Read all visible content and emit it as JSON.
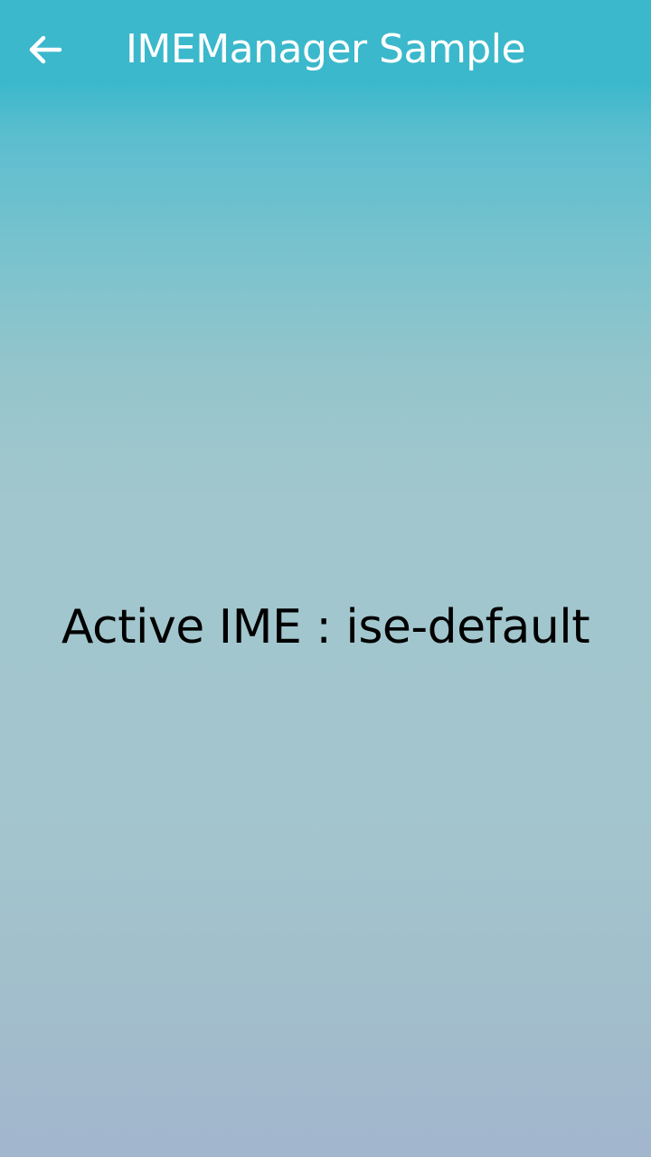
{
  "header": {
    "title": "IMEManager Sample",
    "back_icon": "arrow-left-icon"
  },
  "main": {
    "active_ime_text": "Active IME : ise-default"
  },
  "colors": {
    "header_bg": "#3bb8cb",
    "title_text": "#ffffff",
    "body_text": "#000000",
    "gradient_bottom": "#a2b6cd"
  }
}
